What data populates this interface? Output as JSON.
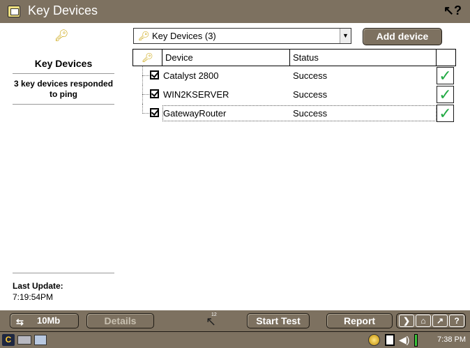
{
  "window": {
    "title": "Key Devices",
    "help_glyph": "↖?"
  },
  "left_panel": {
    "key_icon": "key-icon",
    "title": "Key Devices",
    "description": "3 key devices responded to ping",
    "last_update_label": "Last Update:",
    "last_update_time": "7:19:54PM"
  },
  "filter": {
    "selected": "Key Devices (3)"
  },
  "add_device_label": "Add device",
  "table": {
    "headers": {
      "device": "Device",
      "status": "Status"
    },
    "rows": [
      {
        "device": "Catalyst 2800",
        "status": "Success",
        "checked": true,
        "ok": true
      },
      {
        "device": "WIN2KSERVER",
        "status": "Success",
        "checked": true,
        "ok": true
      },
      {
        "device": "GatewayRouter",
        "status": "Success",
        "checked": true,
        "ok": true
      }
    ]
  },
  "toolbar": {
    "speed_label": "10Mb",
    "details_label": "Details",
    "start_test_label": "Start Test",
    "report_label": "Report",
    "cursor_number": "12"
  },
  "statusbar": {
    "clock": "7:38 PM"
  },
  "colors": {
    "chrome": "#7d7160",
    "check_green": "#22aa44",
    "key_gold": "#c8a000"
  }
}
